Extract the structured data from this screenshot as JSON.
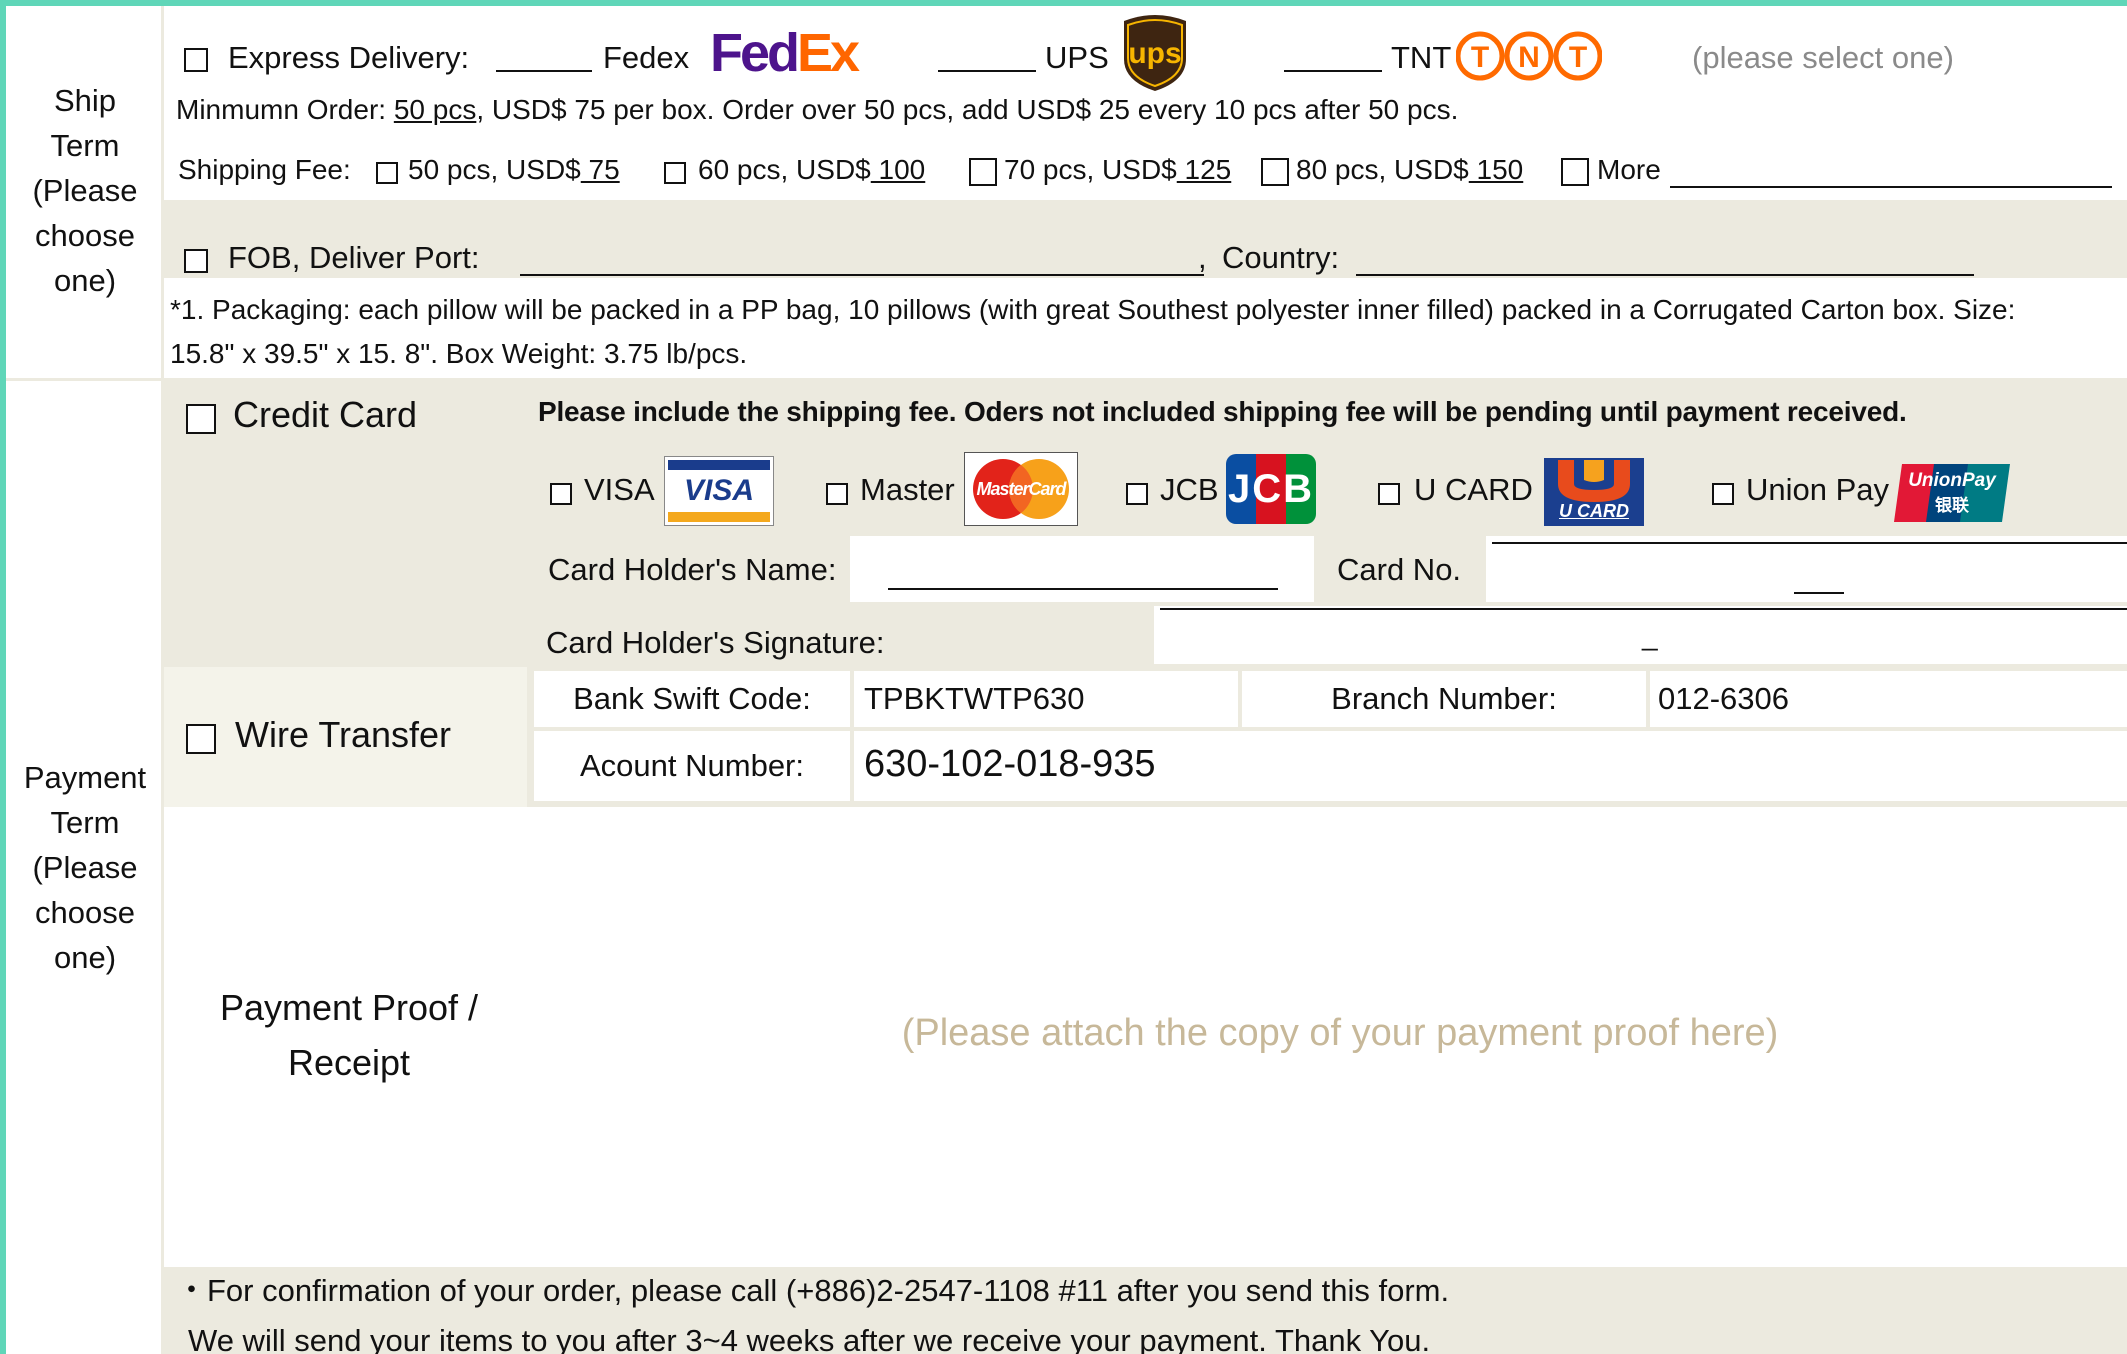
{
  "colors": {
    "frame": "#5fd6b8",
    "band": "#eceadf",
    "light": "#f4f3ea",
    "placeholder_text": "#c7b899",
    "hint_text": "#8a8a8a",
    "fedex_purple": "#4d148c",
    "fedex_orange": "#ff6600",
    "ups_brown": "#3e2511",
    "ups_gold": "#f7b500",
    "tnt_orange": "#ff6a00"
  },
  "ship_term": {
    "label_lines": [
      "Ship",
      "Term",
      "(Please",
      "choose",
      "one)"
    ],
    "express": {
      "label": "Express Delivery:",
      "carriers": [
        {
          "name": "Fedex",
          "logo_icon": "fedex-logo"
        },
        {
          "name": "UPS",
          "logo_icon": "ups-logo"
        },
        {
          "name": "TNT",
          "logo_icon": "tnt-logo"
        }
      ],
      "hint": "(please select one)"
    },
    "minimum_order": {
      "prefix": "Minmumn Order:",
      "qty": " 50 pcs",
      "rest": ", USD$ 75 per box. Order over 50 pcs, add USD$ 25 every 10 pcs after 50 pcs."
    },
    "shipping_fee": {
      "label": "Shipping Fee:",
      "options": [
        {
          "text": "50 pcs, USD$",
          "amount": " 75 "
        },
        {
          "text": "60 pcs, USD$",
          "amount": " 100 "
        },
        {
          "text": "70 pcs, USD$",
          "amount": " 125"
        },
        {
          "text": "80 pcs, USD$",
          "amount": " 150"
        }
      ],
      "more": "More"
    },
    "fob": {
      "label": "FOB, Deliver Port:",
      "comma": ",",
      "country": "Country:"
    },
    "packaging_note_1": "*1. Packaging: each pillow will be packed in a PP bag, 10 pillows (with great Southest polyester inner filled) packed in a Corrugated Carton box. Size:",
    "packaging_note_2": "15.8\" x  39.5\" x 15. 8\". Box Weight: 3.75 lb/pcs."
  },
  "payment_term": {
    "label_lines": [
      "Payment",
      "Term",
      "(Please",
      "choose",
      "one)"
    ],
    "credit_card": {
      "label": "Credit Card",
      "notice": "Please include the shipping fee. Oders not included shipping fee will be pending until payment received.",
      "cards": [
        {
          "name": "VISA",
          "logo_text": "VISA"
        },
        {
          "name": "Master",
          "logo_text": "MasterCard"
        },
        {
          "name": "JCB",
          "logo_text": "JCB"
        },
        {
          "name": "U CARD",
          "logo_text": "U CARD"
        },
        {
          "name": "Union Pay",
          "logo_text": "UnionPay",
          "logo_sub": "银联"
        }
      ],
      "holder_name": "Card Holder's Name:",
      "card_no": "Card No.",
      "signature": "Card Holder's Signature:",
      "sig_mark": "_"
    },
    "wire": {
      "label": "Wire Transfer",
      "swift_label": "Bank Swift Code:",
      "swift_value": "TPBKTWTP630",
      "branch_label": "Branch Number:",
      "branch_value": "012-6306",
      "account_label": "Acount Number:",
      "account_value": "630-102-018-935"
    },
    "proof": {
      "label_lines": [
        "Payment Proof /",
        "Receipt"
      ],
      "placeholder": "(Please attach the copy of your payment proof here)"
    }
  },
  "footer": {
    "line1": "・For confirmation of your order, please call (+886)2-2547-1108 #11 after you send this form.",
    "line2": "We will send your items to you after 3~4 weeks after we receive your payment. Thank You."
  }
}
